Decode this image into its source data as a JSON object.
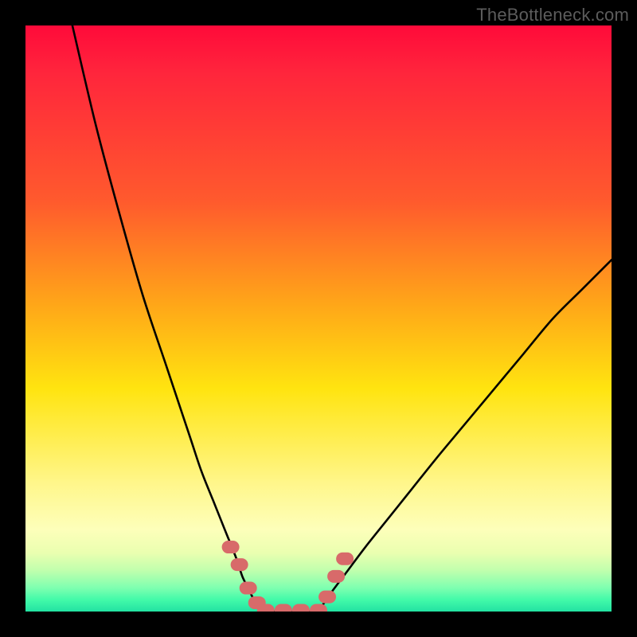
{
  "watermark": {
    "text": "TheBottleneck.com"
  },
  "colors": {
    "curve_stroke": "#000000",
    "marker_fill": "#d86a6a",
    "background_frame": "#000000"
  },
  "chart_data": {
    "type": "line",
    "title": "",
    "xlabel": "",
    "ylabel": "",
    "xlim": [
      0,
      100
    ],
    "ylim": [
      0,
      100
    ],
    "grid": false,
    "legend": false,
    "series": [
      {
        "name": "left-curve",
        "x": [
          8,
          12,
          16,
          20,
          24,
          28,
          30,
          32,
          34,
          36,
          37,
          38,
          39,
          40,
          41
        ],
        "values": [
          100,
          83,
          68,
          54,
          42,
          30,
          24,
          19,
          14,
          9,
          6,
          4,
          2,
          1,
          0
        ]
      },
      {
        "name": "valley-floor",
        "x": [
          41,
          44,
          47,
          50
        ],
        "values": [
          0,
          0,
          0,
          0
        ]
      },
      {
        "name": "right-curve",
        "x": [
          50,
          52,
          55,
          58,
          62,
          66,
          70,
          75,
          80,
          85,
          90,
          95,
          100
        ],
        "values": [
          0,
          3,
          7,
          11,
          16,
          21,
          26,
          32,
          38,
          44,
          50,
          55,
          60
        ]
      }
    ],
    "markers": [
      {
        "x": 35.0,
        "y": 11.0
      },
      {
        "x": 36.5,
        "y": 8.0
      },
      {
        "x": 38.0,
        "y": 4.0
      },
      {
        "x": 39.5,
        "y": 1.5
      },
      {
        "x": 41.0,
        "y": 0.2
      },
      {
        "x": 44.0,
        "y": 0.2
      },
      {
        "x": 47.0,
        "y": 0.2
      },
      {
        "x": 50.0,
        "y": 0.2
      },
      {
        "x": 51.5,
        "y": 2.5
      },
      {
        "x": 53.0,
        "y": 6.0
      },
      {
        "x": 54.5,
        "y": 9.0
      }
    ]
  }
}
